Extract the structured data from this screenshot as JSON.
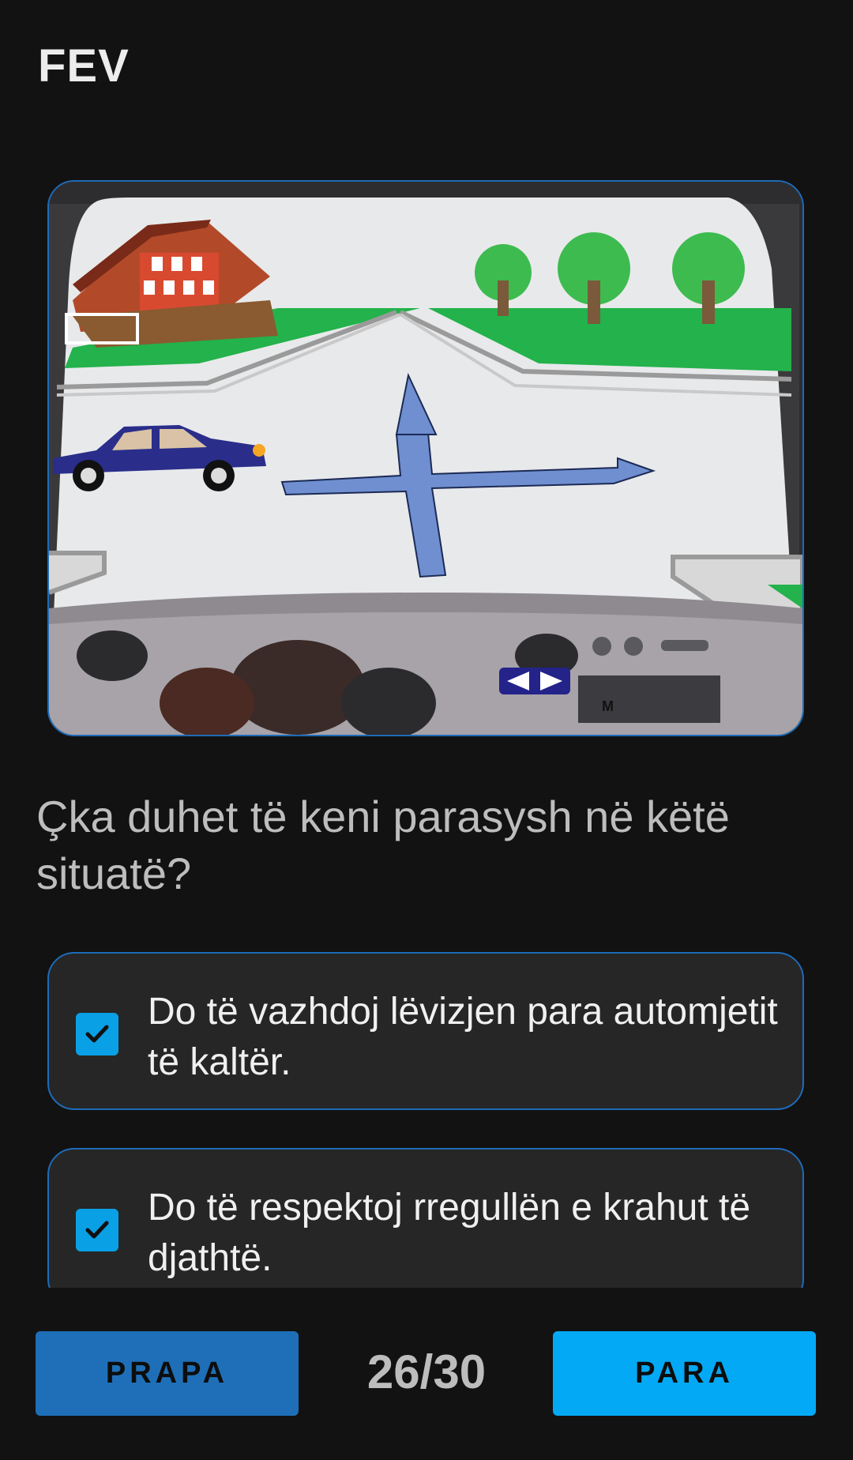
{
  "header": {
    "title": "FEV"
  },
  "image": {
    "description_icon": "traffic-scene-image",
    "dash_label": "M"
  },
  "question": {
    "text": "Çka duhet të keni parasysh në këtë situatë?"
  },
  "answers": [
    {
      "text": "Do të vazhdoj lëvizjen para automjetit të kaltër.",
      "checked": true
    },
    {
      "text": "Do të respektoj rregullën e krahut të djathtë.",
      "checked": true
    }
  ],
  "navigation": {
    "prev_label": "PRAPA",
    "next_label": "PARA",
    "counter": "26/30"
  },
  "colors": {
    "background": "#121212",
    "accent": "#03a9f4",
    "border": "#1e6bb8",
    "prev_button": "#1e6fb8"
  }
}
